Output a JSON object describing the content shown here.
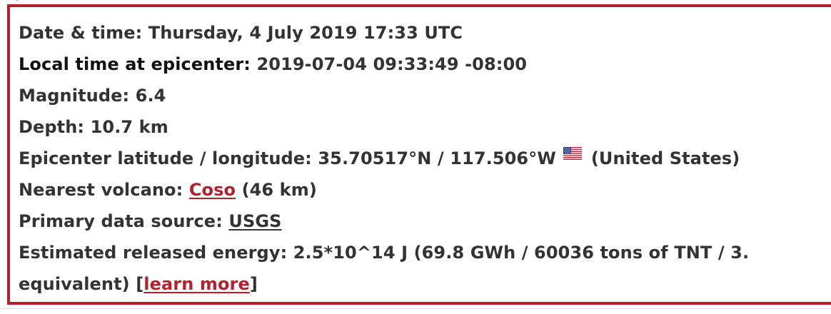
{
  "event": {
    "datetime": {
      "label": "Date & time:",
      "value": "Thursday, 4 July 2019 17:33 UTC"
    },
    "local_time": {
      "label": "Local time at epicenter:",
      "value": "2019-07-04 09:33:49 -08:00"
    },
    "magnitude": {
      "label": "Magnitude:",
      "value": "6.4"
    },
    "depth": {
      "label": "Depth:",
      "value": "10.7 km"
    },
    "epicenter": {
      "label": "Epicenter latitude / longitude:",
      "value": "35.70517°N / 117.506°W",
      "flag_icon": "us-flag-icon",
      "country": "(United States)"
    },
    "volcano": {
      "label": "Nearest volcano:",
      "link": "Coso",
      "distance": "(46 km)"
    },
    "source": {
      "label": "Primary data source:",
      "link": "USGS"
    },
    "energy": {
      "label": "Estimated released energy:",
      "value_line1": "2.5*10^14 J (69.8 GWh / 60036 tons of TNT / 3.",
      "value_line2": "equivalent) [",
      "link": "learn more",
      "suffix": "]"
    }
  },
  "colors": {
    "border": "#b3222c",
    "link": "#b3222c",
    "text": "#333333"
  }
}
